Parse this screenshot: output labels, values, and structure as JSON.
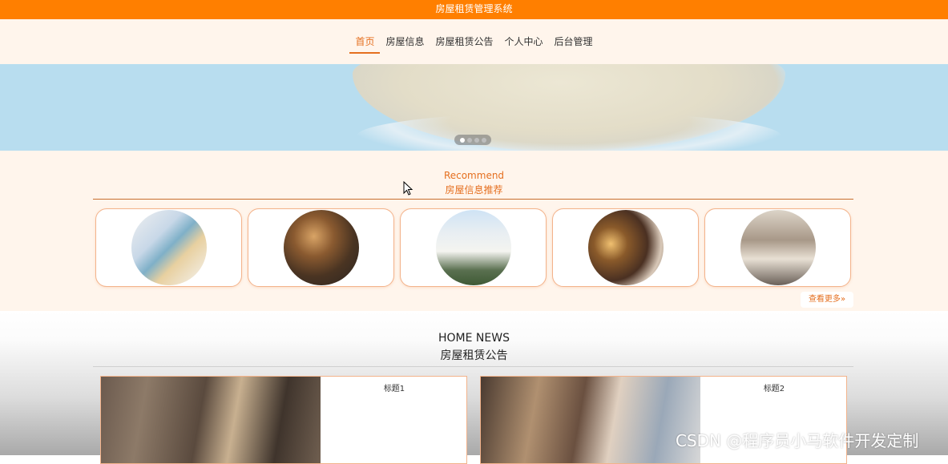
{
  "header": {
    "title": "房屋租赁管理系统"
  },
  "nav": {
    "items": [
      {
        "label": "首页",
        "active": true
      },
      {
        "label": "房屋信息",
        "active": false
      },
      {
        "label": "房屋租赁公告",
        "active": false
      },
      {
        "label": "个人中心",
        "active": false
      },
      {
        "label": "后台管理",
        "active": false
      }
    ]
  },
  "banner": {
    "slide_count": 4,
    "current_slide": 1
  },
  "recommend": {
    "title_en": "Recommend",
    "title_cn": "房屋信息推荐",
    "more_label": "查看更多",
    "more_icon": "double-chevron-right-icon",
    "more_glyph": "»"
  },
  "news": {
    "title_en": "HOME NEWS",
    "title_cn": "房屋租赁公告",
    "items": [
      {
        "title": "标题1"
      },
      {
        "title": "标题2"
      }
    ]
  },
  "watermark": "CSDN @程序员小马软件开发定制",
  "colors": {
    "accent": "#ff7f00",
    "nav_active": "#e56f1f",
    "section_bg": "#fff5ec"
  }
}
